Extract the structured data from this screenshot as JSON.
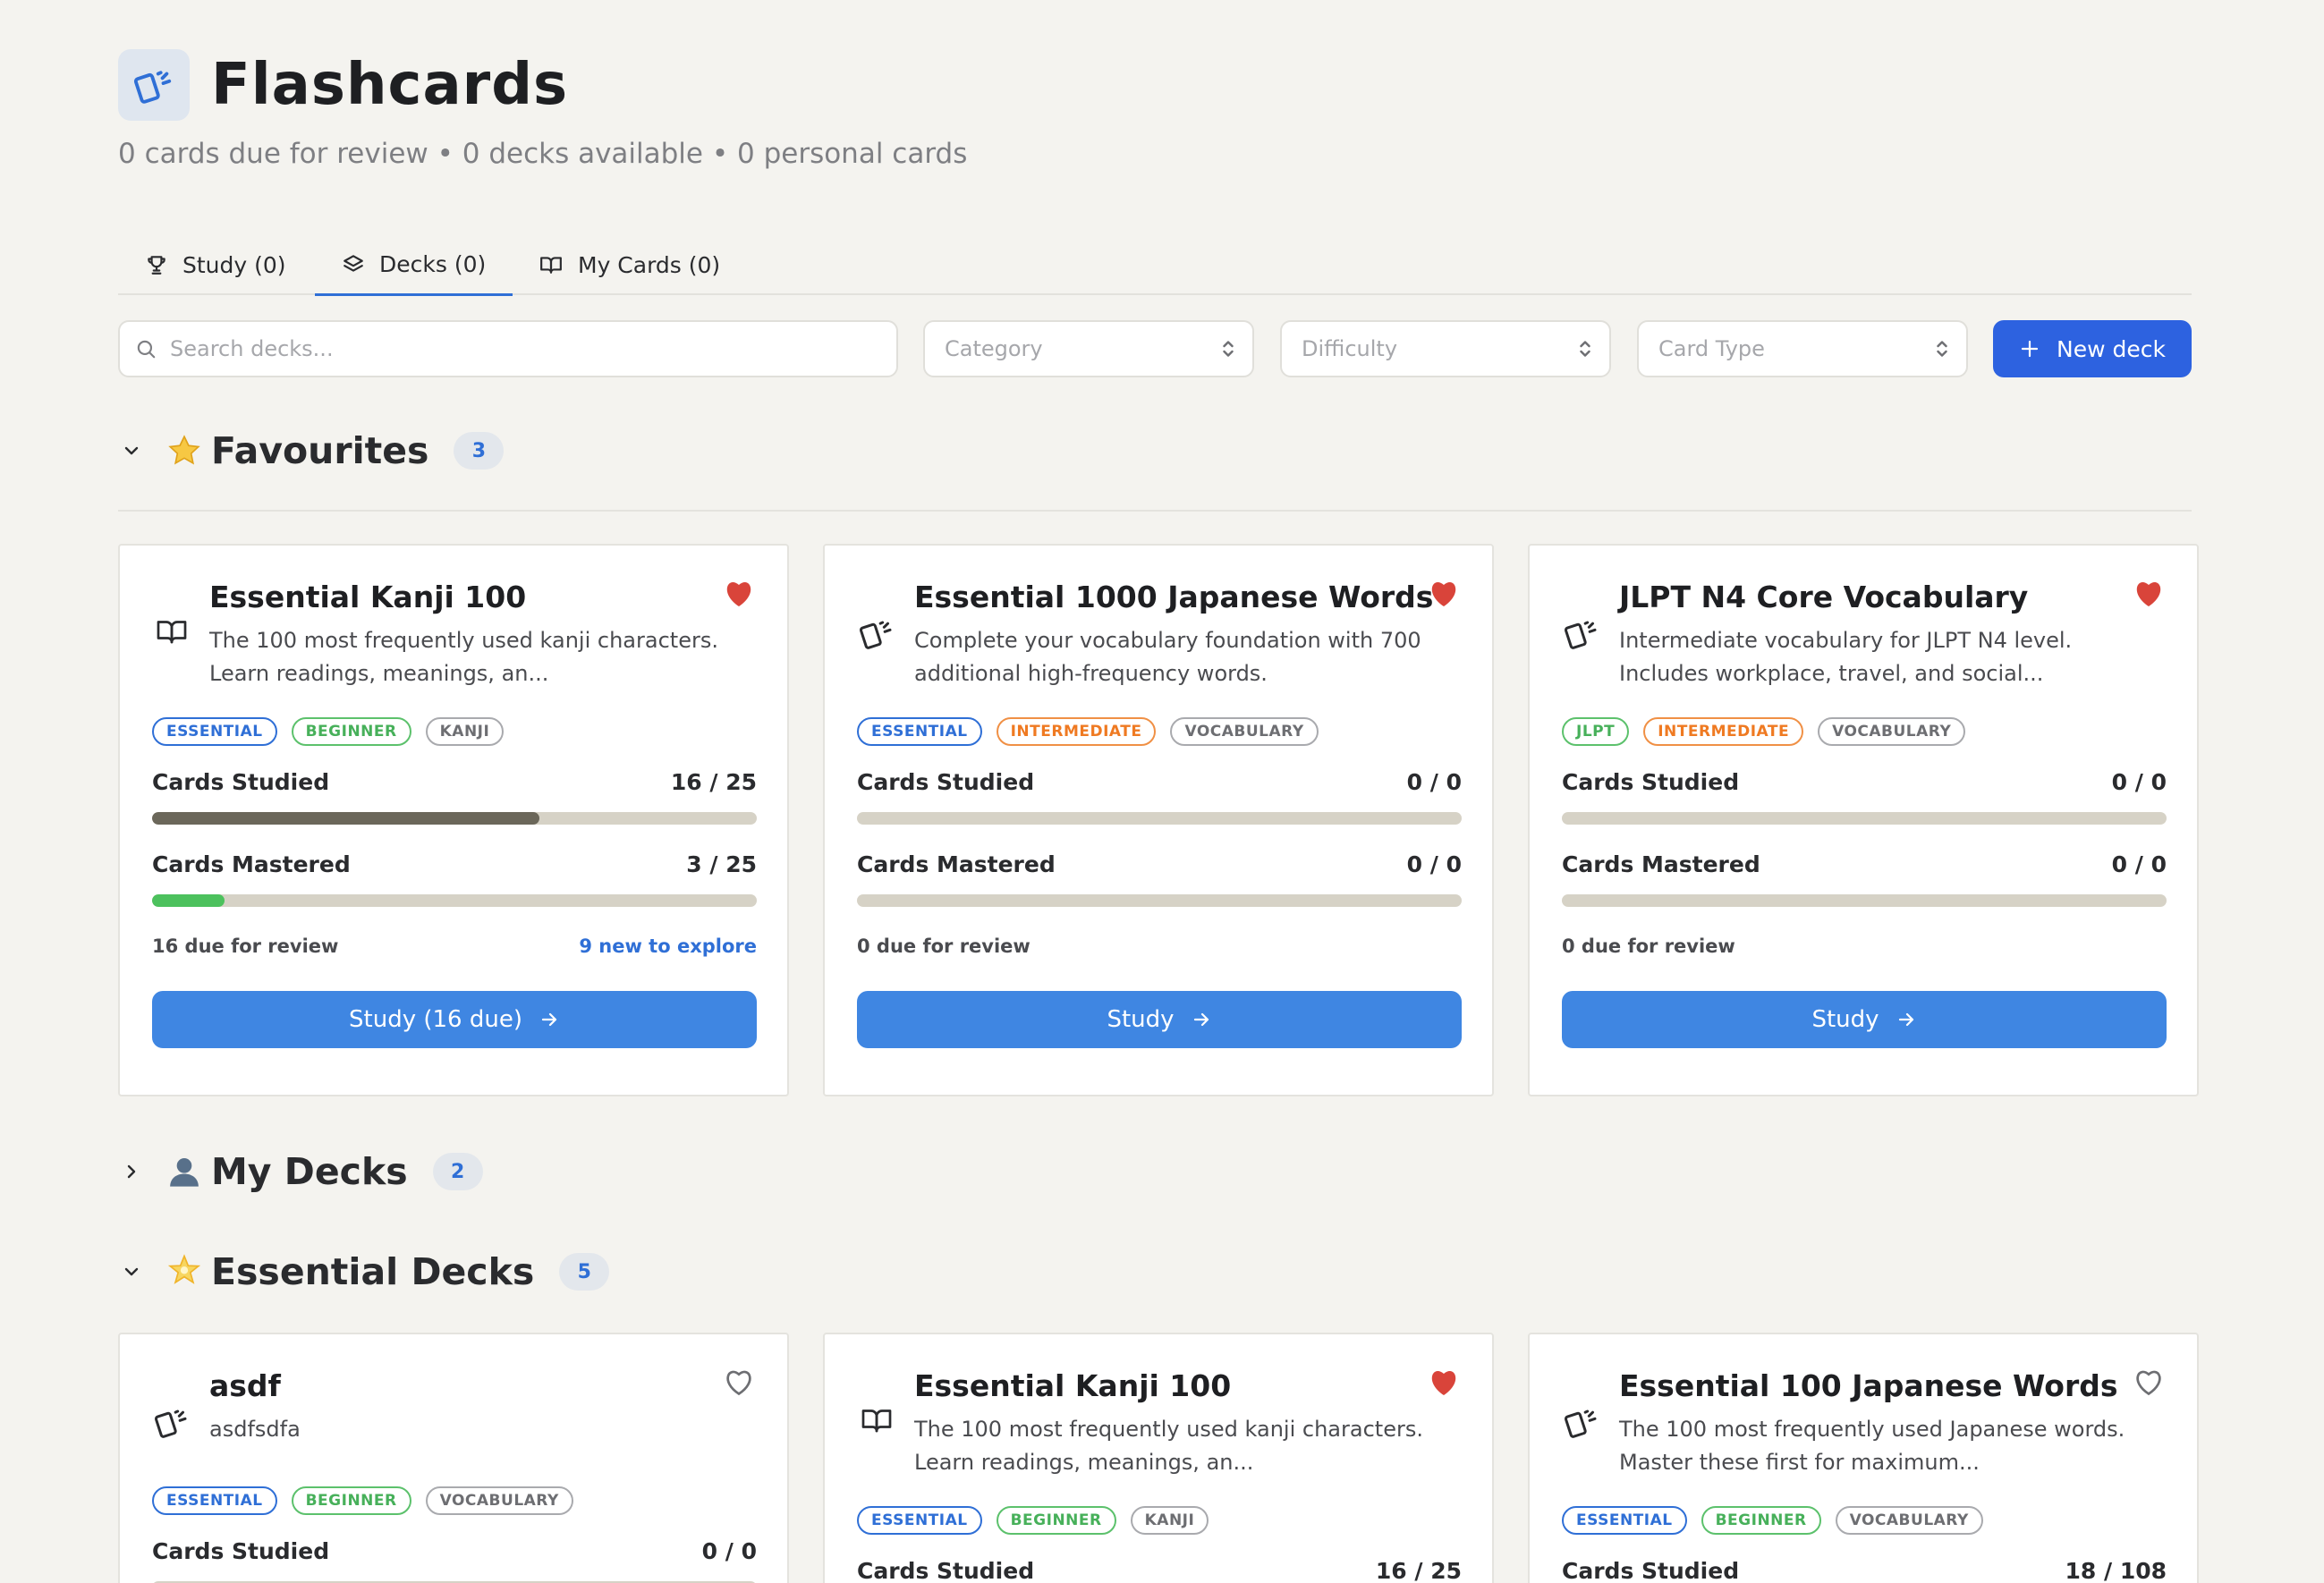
{
  "header": {
    "title": "Flashcards",
    "subtitle": "0 cards due for review • 0 decks available • 0 personal cards",
    "logo_icon": "cards-icon"
  },
  "tabs": [
    {
      "label": "Study (0)",
      "icon": "trophy-icon"
    },
    {
      "label": "Decks (0)",
      "icon": "layers-icon",
      "active": true
    },
    {
      "label": "My Cards (0)",
      "icon": "book-icon"
    }
  ],
  "toolbar": {
    "search_placeholder": "Search decks...",
    "category_placeholder": "Category",
    "difficulty_placeholder": "Difficulty",
    "card_type_placeholder": "Card Type",
    "new_deck_label": "New deck"
  },
  "sections": {
    "favourites": {
      "emoji": "⭐",
      "title": "Favourites",
      "count": "3",
      "expanded": true
    },
    "my_decks": {
      "emoji": "👤",
      "title": "My Decks",
      "count": "2",
      "expanded": false
    },
    "essential": {
      "emoji": "🌟",
      "title": "Essential Decks",
      "count": "5",
      "expanded": true
    }
  },
  "colors": {
    "accent": "#2d62e0",
    "study_button": "#3f86e2",
    "heart": "#d9443a"
  },
  "favourite_cards": [
    {
      "title": "Essential Kanji 100",
      "desc": "The 100 most frequently used kanji characters. Learn readings, meanings, an...",
      "icon": "book-icon",
      "favourited": true,
      "tags": [
        {
          "label": "ESSENTIAL",
          "color": "blue"
        },
        {
          "label": "BEGINNER",
          "color": "green"
        },
        {
          "label": "KANJI",
          "color": "gray"
        }
      ],
      "studied_label": "Cards Studied",
      "studied_value": "16 / 25",
      "studied_fraction": 0.64,
      "mastered_label": "Cards Mastered",
      "mastered_value": "3 / 25",
      "mastered_fraction": 0.12,
      "due_text": "16 due for review",
      "new_text": "9 new to explore",
      "button_label": "Study (16 due)"
    },
    {
      "title": "Essential 1000 Japanese Words",
      "desc": "Complete your vocabulary foundation with 700 additional high-frequency words.",
      "icon": "cards-icon",
      "favourited": true,
      "tags": [
        {
          "label": "ESSENTIAL",
          "color": "blue"
        },
        {
          "label": "INTERMEDIATE",
          "color": "orange"
        },
        {
          "label": "VOCABULARY",
          "color": "gray"
        }
      ],
      "studied_label": "Cards Studied",
      "studied_value": "0 / 0",
      "studied_fraction": 0,
      "mastered_label": "Cards Mastered",
      "mastered_value": "0 / 0",
      "mastered_fraction": 0,
      "due_text": "0 due for review",
      "new_text": "",
      "button_label": "Study"
    },
    {
      "title": "JLPT N4 Core Vocabulary",
      "desc": "Intermediate vocabulary for JLPT N4 level. Includes workplace, travel, and social...",
      "icon": "cards-icon",
      "favourited": true,
      "tags": [
        {
          "label": "JLPT",
          "color": "green"
        },
        {
          "label": "INTERMEDIATE",
          "color": "orange"
        },
        {
          "label": "VOCABULARY",
          "color": "gray"
        }
      ],
      "studied_label": "Cards Studied",
      "studied_value": "0 / 0",
      "studied_fraction": 0,
      "mastered_label": "Cards Mastered",
      "mastered_value": "0 / 0",
      "mastered_fraction": 0,
      "due_text": "0 due for review",
      "new_text": "",
      "button_label": "Study"
    }
  ],
  "essential_cards": [
    {
      "title": "asdf",
      "desc": "asdfsdfa",
      "icon": "cards-icon",
      "favourited": false,
      "tags": [
        {
          "label": "ESSENTIAL",
          "color": "blue"
        },
        {
          "label": "BEGINNER",
          "color": "green"
        },
        {
          "label": "VOCABULARY",
          "color": "gray"
        }
      ],
      "studied_label": "Cards Studied",
      "studied_value": "0 / 0",
      "studied_fraction": 0
    },
    {
      "title": "Essential Kanji 100",
      "desc": "The 100 most frequently used kanji characters. Learn readings, meanings, an...",
      "icon": "book-icon",
      "favourited": true,
      "tags": [
        {
          "label": "ESSENTIAL",
          "color": "blue"
        },
        {
          "label": "BEGINNER",
          "color": "green"
        },
        {
          "label": "KANJI",
          "color": "gray"
        }
      ],
      "studied_label": "Cards Studied",
      "studied_value": "16 / 25",
      "studied_fraction": 0.64
    },
    {
      "title": "Essential 100 Japanese Words",
      "desc": "The 100 most frequently used Japanese words. Master these first for maximum...",
      "icon": "cards-icon",
      "favourited": false,
      "tags": [
        {
          "label": "ESSENTIAL",
          "color": "blue"
        },
        {
          "label": "BEGINNER",
          "color": "green"
        },
        {
          "label": "VOCABULARY",
          "color": "gray"
        }
      ],
      "studied_label": "Cards Studied",
      "studied_value": "18 / 108",
      "studied_fraction": 0.17
    }
  ]
}
